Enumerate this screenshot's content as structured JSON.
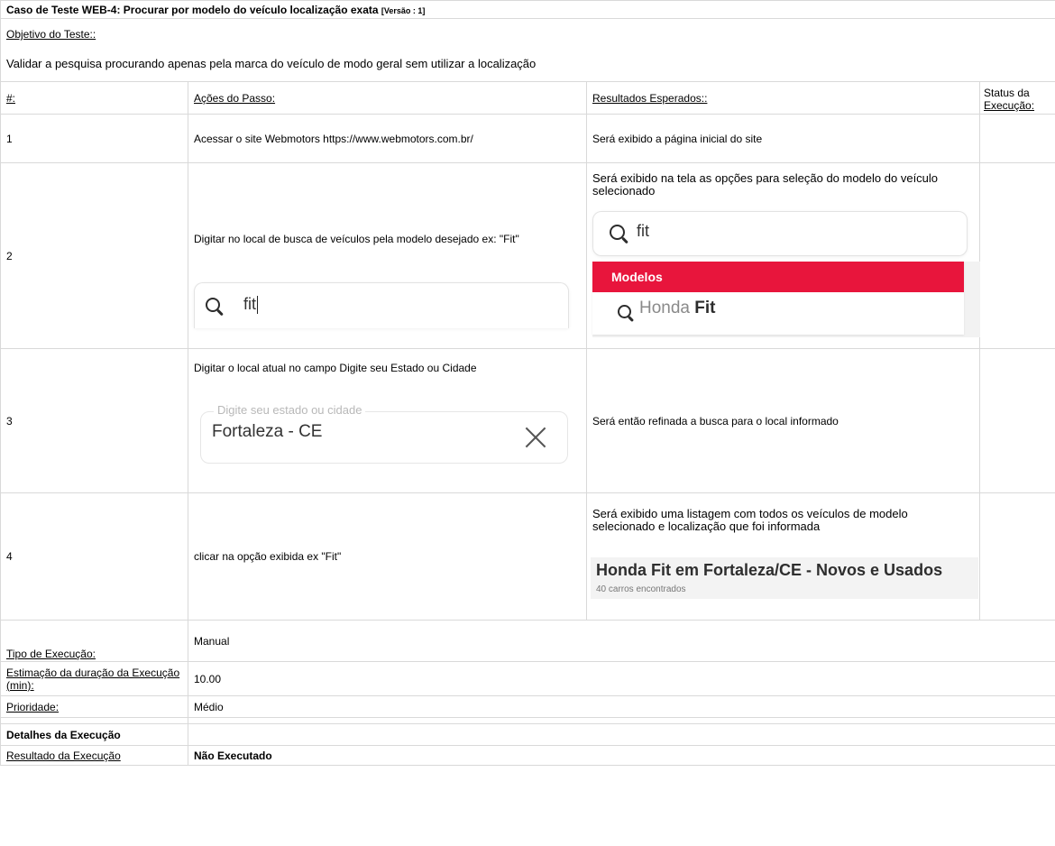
{
  "header": {
    "title": "Caso de Teste WEB-4: Procurar por modelo do veículo localização exata",
    "version": "[Versão : 1]",
    "objective_label": "Objetivo do Teste::",
    "objective_text": "Validar a pesquisa procurando apenas pela marca do veículo de modo geral sem utilizar a localização"
  },
  "columns": {
    "num": "#:",
    "actions": "Ações do Passo:",
    "expected": "Resultados Esperados::",
    "status_line1": "Status da",
    "status_line2": "Execução:"
  },
  "steps": [
    {
      "num": "1",
      "action": "Acessar o site Webmotors https://www.webmotors.com.br/",
      "expected": "Será exibido a página inicial do site",
      "status": ""
    },
    {
      "num": "2",
      "action": "Digitar no local de busca de veículos pela modelo desejado ex: \"Fit\"",
      "action_search_value": "fit",
      "expected": "Será exibido na tela as opções para seleção do modelo do veículo selecionado",
      "expected_search_value": "fit",
      "expected_dropdown_header": "Modelos",
      "expected_option_prefix": "Honda ",
      "expected_option_bold": "Fit",
      "status": ""
    },
    {
      "num": "3",
      "action": "Digitar o local atual no campo Digite seu Estado ou Cidade",
      "location_legend": "Digite seu estado ou cidade",
      "location_value": "Fortaleza - CE",
      "expected": "Será então refinada a busca para o local informado",
      "status": ""
    },
    {
      "num": "4",
      "action": "clicar na opção exibida ex \"Fit\"",
      "expected": "Será exibido uma listagem com todos os veículos de modelo selecionado e localização que foi informada",
      "result_title": "Honda Fit em Fortaleza/CE - Novos e Usados",
      "result_count": "40 carros encontrados",
      "status": ""
    }
  ],
  "meta": {
    "exec_type_label": "Tipo de Execução:",
    "exec_type_value": "Manual",
    "duration_label": "Estimação da duração da Execução (min):",
    "duration_value": "10.00",
    "priority_label": "Prioridade:",
    "priority_value": "Médio"
  },
  "execution": {
    "details_label": "Detalhes da Execução",
    "result_label": "Resultado da Execução",
    "result_value": "Não Executado"
  },
  "colors": {
    "accent_red": "#e8153c",
    "border": "#d9d9d9"
  }
}
